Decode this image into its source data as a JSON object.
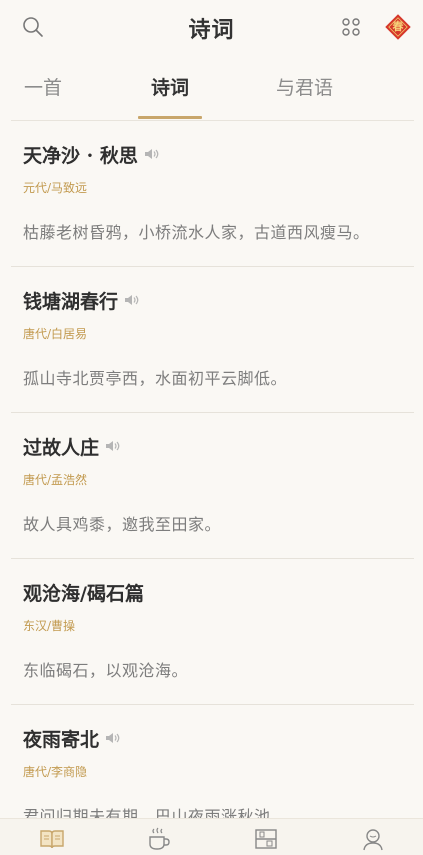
{
  "header": {
    "title": "诗词",
    "search_icon": "search-icon",
    "grid_icon": "grid-icon",
    "badge": {
      "text": "春",
      "color": "#d6372a"
    }
  },
  "tabs": [
    {
      "label": "一首",
      "active": false
    },
    {
      "label": "诗词",
      "active": true
    },
    {
      "label": "与君语",
      "active": false
    }
  ],
  "poems": [
    {
      "title": "天净沙 · 秋思",
      "author": "元代/马致远",
      "line": "枯藤老树昏鸦，小桥流水人家，古道西风瘦马。",
      "audio": true
    },
    {
      "title": "钱塘湖春行",
      "author": "唐代/白居易",
      "line": "孤山寺北贾亭西，水面初平云脚低。",
      "audio": true
    },
    {
      "title": "过故人庄",
      "author": "唐代/孟浩然",
      "line": "故人具鸡黍，邀我至田家。",
      "audio": true
    },
    {
      "title": "观沧海/碣石篇",
      "author": "东汉/曹操",
      "line": "东临碣石，以观沧海。",
      "audio": false
    },
    {
      "title": "夜雨寄北",
      "author": "唐代/李商隐",
      "line": "君问归期未有期，巴山夜雨涨秋池。",
      "audio": true
    }
  ],
  "bottom_nav": [
    {
      "icon": "book-icon",
      "active": true
    },
    {
      "icon": "tea-cup-icon",
      "active": false
    },
    {
      "icon": "bookshelf-icon",
      "active": false
    },
    {
      "icon": "profile-icon",
      "active": false
    }
  ],
  "colors": {
    "accent": "#c8a66b",
    "author": "#c29a4f",
    "background": "#faf8f4"
  }
}
